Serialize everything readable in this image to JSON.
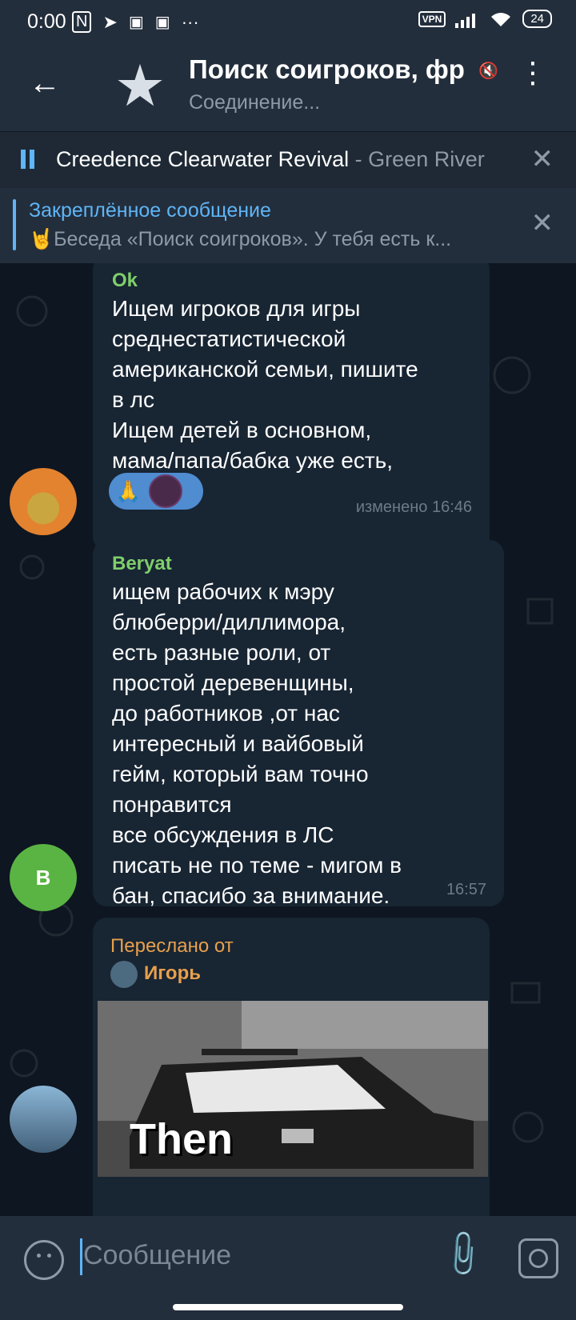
{
  "status_bar": {
    "time": "0:00",
    "vpn": "VPN",
    "battery": "24"
  },
  "header": {
    "title": "Поиск соигроков, фр",
    "subtitle": "Соединение..."
  },
  "player": {
    "artist": "Creedence Clearwater Revival",
    "separator": " - ",
    "song": "Green River"
  },
  "pinned": {
    "title": "Закреплённое сообщение",
    "text": "🤘Беседа «Поиск соигроков». У тебя есть к..."
  },
  "messages": [
    {
      "sender": "Ok",
      "sender_color": "#7ecf6a",
      "text": "Ищем игроков для игры\nсреднестатистической\nамериканской семьи, пишите\nв лс\nИщем детей в основном,\nмама/папа/бабка уже есть,",
      "reaction": "🙏",
      "meta": "изменено 16:46"
    },
    {
      "sender": "Beryat",
      "sender_color": "#7ecf6a",
      "avatar_letter": "B",
      "text": "ищем рабочих к мэру\nблюберри/диллимора,\nесть разные роли, от\nпростой деревенщины,\nдо работников ,от нас\nинтересный и вайбовый\nгейм, который вам точно\nпонравится\nвсе обсуждения в ЛС\nписать не по теме - мигом в\nбан, спасибо за внимание.",
      "meta": "16:57"
    },
    {
      "forwarded_label": "Переслано от",
      "forwarded_from": "Игорь",
      "media_text": "Then"
    }
  ],
  "input": {
    "placeholder": "Сообщение"
  },
  "colors": {
    "accent": "#5eb5f7",
    "forward": "#e8a04d",
    "name_green": "#7ecf6a"
  }
}
